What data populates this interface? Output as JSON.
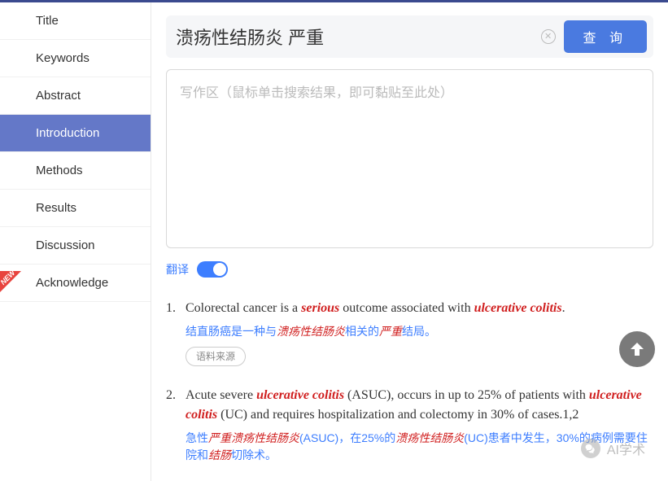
{
  "sidebar": {
    "items": [
      {
        "label": "Title",
        "active": false
      },
      {
        "label": "Keywords",
        "active": false
      },
      {
        "label": "Abstract",
        "active": false
      },
      {
        "label": "Introduction",
        "active": true
      },
      {
        "label": "Methods",
        "active": false
      },
      {
        "label": "Results",
        "active": false
      },
      {
        "label": "Discussion",
        "active": false
      },
      {
        "label": "Acknowledge",
        "active": false
      }
    ],
    "new_badge": "NEW"
  },
  "search": {
    "value": "溃疡性结肠炎 严重",
    "query_button": "查 询"
  },
  "writing_area": {
    "placeholder": "写作区（鼠标单击搜索结果，即可黏贴至此处）"
  },
  "translate": {
    "label": "翻译",
    "on": true
  },
  "results": [
    {
      "num": "1.",
      "segments": [
        {
          "t": "Colorectal cancer is a ",
          "c": ""
        },
        {
          "t": "serious",
          "c": "hl-red"
        },
        {
          "t": " outcome associated with ",
          "c": ""
        },
        {
          "t": "ulcerative colitis",
          "c": "hl-red"
        },
        {
          "t": ".",
          "c": ""
        }
      ],
      "translation_segments": [
        {
          "t": "结直肠癌是一种与",
          "c": ""
        },
        {
          "t": "溃疡性结肠炎",
          "c": "hl-key"
        },
        {
          "t": "相关的",
          "c": ""
        },
        {
          "t": "严重",
          "c": "hl-key"
        },
        {
          "t": "结局。",
          "c": ""
        }
      ],
      "source_label": "语料来源"
    },
    {
      "num": "2.",
      "segments": [
        {
          "t": "Acute severe ",
          "c": ""
        },
        {
          "t": "ulcerative colitis",
          "c": "hl-red"
        },
        {
          "t": " (ASUC), occurs in up to 25% of patients with ",
          "c": ""
        },
        {
          "t": "ulcerative colitis",
          "c": "hl-red"
        },
        {
          "t": " (UC) and requires hospitalization and colectomy in 30% of cases.1,2",
          "c": ""
        }
      ],
      "translation_segments": [
        {
          "t": "急性",
          "c": ""
        },
        {
          "t": "严重溃疡性结肠炎",
          "c": "hl-key"
        },
        {
          "t": "(ASUC)，在25%的",
          "c": ""
        },
        {
          "t": "溃疡性结肠炎",
          "c": "hl-key"
        },
        {
          "t": "(UC)患者中发生，30%的病例需要住院和",
          "c": ""
        },
        {
          "t": "结肠",
          "c": "hl-key"
        },
        {
          "t": "切除术。",
          "c": ""
        }
      ]
    }
  ],
  "watermark": "AI学术"
}
